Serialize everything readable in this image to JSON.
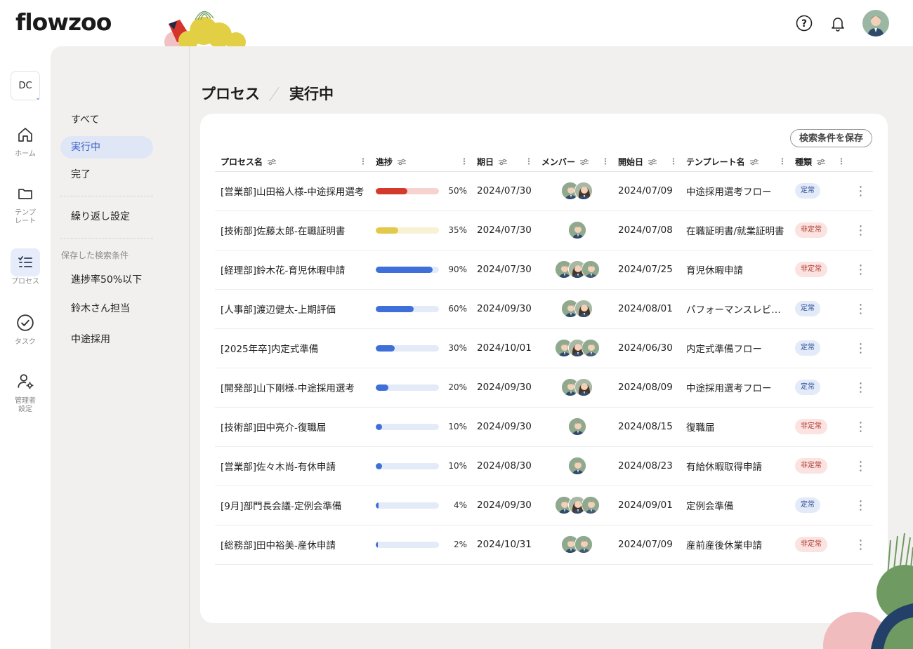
{
  "app": {
    "logo": "flowzoo"
  },
  "header": {
    "icons": [
      "help-icon",
      "bell-icon"
    ],
    "avatar": "user-avatar"
  },
  "rail": {
    "org_label": "DC",
    "items": [
      {
        "label": "ホーム",
        "icon": "home-icon"
      },
      {
        "label": "テンプレート",
        "icon": "folder-icon"
      },
      {
        "label": "プロセス",
        "icon": "checklist-icon"
      },
      {
        "label": "タスク",
        "icon": "check-circle-icon"
      },
      {
        "label": "管理者設定",
        "icon": "admin-settings-icon"
      }
    ]
  },
  "subnav": {
    "items": [
      "すべて",
      "実行中",
      "完了"
    ],
    "repeat": "繰り返し設定",
    "saved_heading": "保存した検索条件",
    "saved": [
      "進捗率50%以下",
      "鈴木さん担当",
      "中途採用"
    ]
  },
  "breadcrumb": {
    "root": "プロセス",
    "current": "実行中"
  },
  "toolbar": {
    "save_search": "検索条件を保存"
  },
  "table": {
    "columns": [
      "プロセス名",
      "進捗",
      "期日",
      "メンバー",
      "開始日",
      "テンプレート名",
      "種類"
    ],
    "rows": [
      {
        "name": "[営業部]山田裕人様-中途採用選考",
        "progress": 50,
        "pct": "50%",
        "due": "2024/07/30",
        "members": 2,
        "start": "2024/07/09",
        "template": "中途採用選考フロー",
        "type": "定常",
        "kind": "normal",
        "color": "#d33a2c",
        "track": "#f6d3cf"
      },
      {
        "name": "[技術部]佐藤太郎-在職証明書",
        "progress": 35,
        "pct": "35%",
        "due": "2024/07/30",
        "members": 1,
        "start": "2024/07/08",
        "template": "在職証明書/就業証明書",
        "type": "非定常",
        "kind": "abnormal",
        "color": "#e2c94a",
        "track": "#f8f1d3"
      },
      {
        "name": "[経理部]鈴木花-育児休暇申請",
        "progress": 90,
        "pct": "90%",
        "due": "2024/07/30",
        "members": 3,
        "start": "2024/07/25",
        "template": "育児休暇申請",
        "type": "非定常",
        "kind": "abnormal",
        "color": "#3f6fd8",
        "track": "#e4ebf8"
      },
      {
        "name": "[人事部]渡辺健太-上期評価",
        "progress": 60,
        "pct": "60%",
        "due": "2024/09/30",
        "members": 2,
        "start": "2024/08/01",
        "template": "パフォーマンスレビュー",
        "type": "定常",
        "kind": "normal",
        "color": "#3f6fd8",
        "track": "#e4ebf8"
      },
      {
        "name": "[2025年卒]内定式準備",
        "progress": 30,
        "pct": "30%",
        "due": "2024/10/01",
        "members": 3,
        "start": "2024/06/30",
        "template": "内定式準備フロー",
        "type": "定常",
        "kind": "normal",
        "color": "#3f6fd8",
        "track": "#e4ebf8"
      },
      {
        "name": "[開発部]山下剛様-中途採用選考",
        "progress": 20,
        "pct": "20%",
        "due": "2024/09/30",
        "members": 2,
        "start": "2024/08/09",
        "template": "中途採用選考フロー",
        "type": "定常",
        "kind": "normal",
        "color": "#3f6fd8",
        "track": "#e4ebf8"
      },
      {
        "name": "[技術部]田中亮介-復職届",
        "progress": 10,
        "pct": "10%",
        "due": "2024/09/30",
        "members": 1,
        "start": "2024/08/15",
        "template": "復職届",
        "type": "非定常",
        "kind": "abnormal",
        "color": "#3f6fd8",
        "track": "#e4ebf8"
      },
      {
        "name": "[営業部]佐々木尚-有休申請",
        "progress": 10,
        "pct": "10%",
        "due": "2024/08/30",
        "members": 1,
        "start": "2024/08/23",
        "template": "有給休暇取得申請",
        "type": "非定常",
        "kind": "abnormal",
        "color": "#3f6fd8",
        "track": "#e4ebf8"
      },
      {
        "name": "[9月]部門長会議-定例会準備",
        "progress": 4,
        "pct": "4%",
        "due": "2024/09/30",
        "members": 3,
        "start": "2024/09/01",
        "template": "定例会準備",
        "type": "定常",
        "kind": "normal",
        "color": "#3f6fd8",
        "track": "#e4ebf8"
      },
      {
        "name": "[総務部]田中裕美-産休申請",
        "progress": 2,
        "pct": "2%",
        "due": "2024/10/31",
        "members": 2,
        "start": "2024/07/09",
        "template": "産前産後休業申請",
        "type": "非定常",
        "kind": "abnormal",
        "color": "#3f6fd8",
        "track": "#e4ebf8"
      }
    ]
  }
}
